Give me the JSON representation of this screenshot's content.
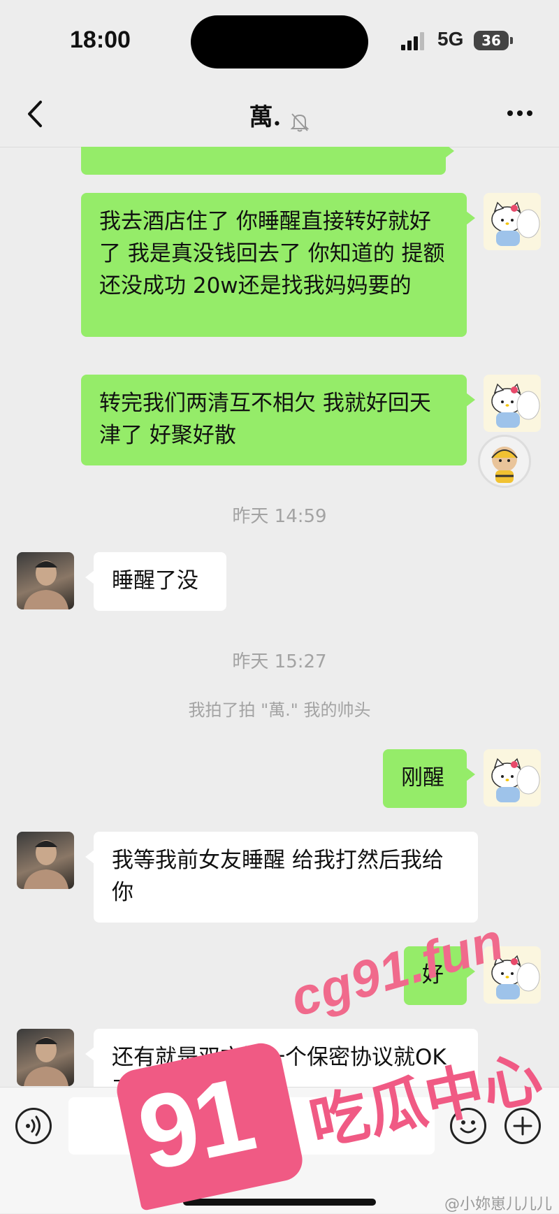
{
  "status_bar": {
    "time": "18:00",
    "network": "5G",
    "battery": "36"
  },
  "header": {
    "title": "萬."
  },
  "messages": {
    "partial_top": "",
    "m1": "我去酒店住了 你睡醒直接转好就好了 我是真没钱回去了 你知道的 提额还没成功 20w还是找我妈妈要的",
    "m2": "转完我们两清互不相欠 我就好回天津了 好聚好散",
    "ts1": "昨天 14:59",
    "m3": "睡醒了没",
    "ts2": "昨天 15:27",
    "system1": "我拍了拍 \"萬.\" 我的帅头",
    "m4": "刚醒",
    "m5": "我等我前女友睡醒 给我打然后我给你",
    "m6": "好",
    "m7": "还有就是双方签一个保密协议就OK了"
  },
  "input_bar": {
    "placeholder": ""
  },
  "watermark": {
    "domain": "cg91.fun",
    "number": "91",
    "text": "吃瓜中心"
  },
  "credit": "@小妳崽儿儿儿",
  "colors": {
    "bubble_me": "#95ec69",
    "bubble_them": "#ffffff",
    "chat_bg": "#ededed",
    "watermark": "#f05a84"
  }
}
